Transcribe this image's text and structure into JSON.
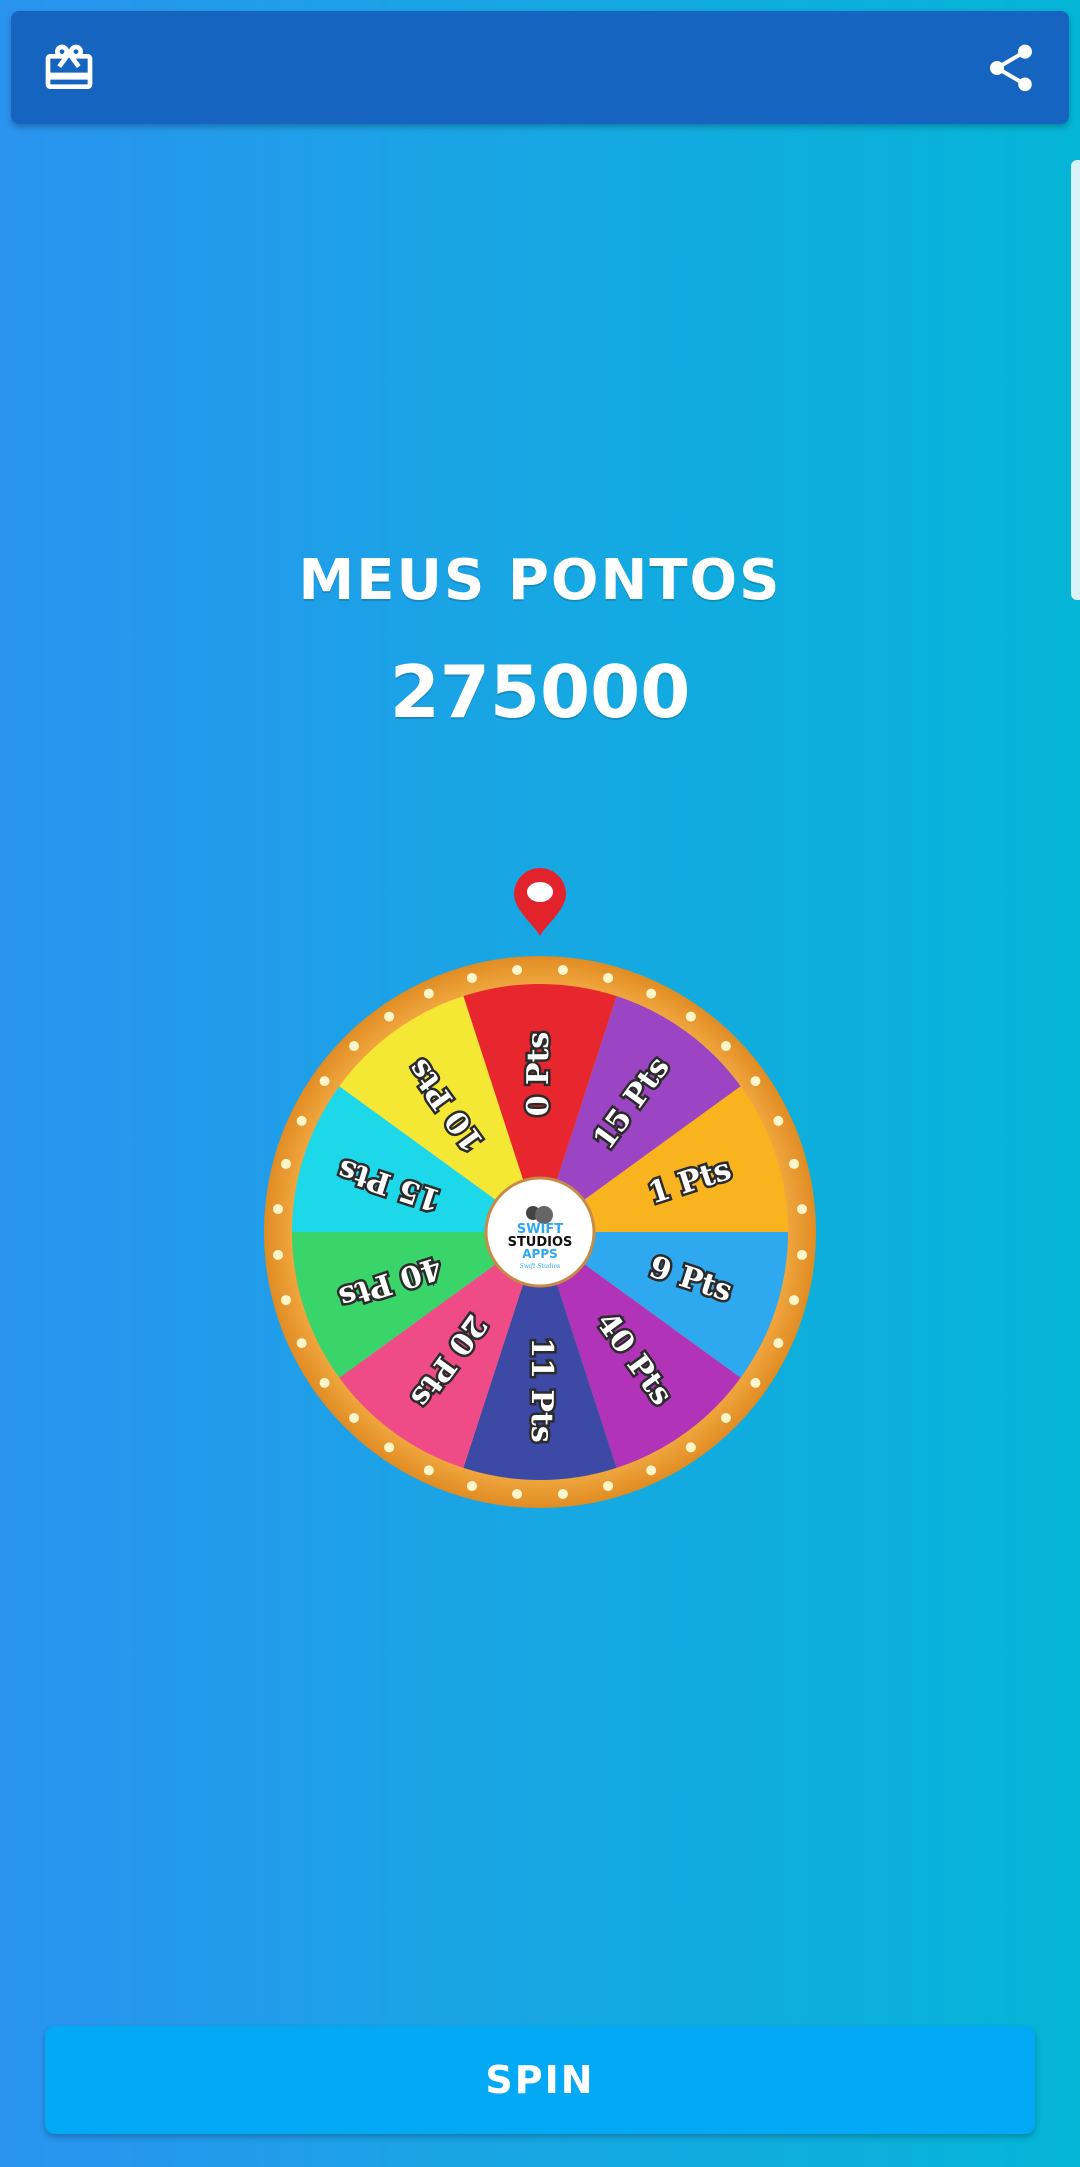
{
  "toolbar": {
    "left_icon": "gift-card-icon",
    "right_icon": "share-icon"
  },
  "points_panel": {
    "title": "MEUS PONTOS",
    "value": "275000"
  },
  "wheel": {
    "pointer_icon": "map-pin-icon",
    "center_logo": {
      "line1": "SWIFT",
      "line2": "STUDIOS",
      "line3": "APPS",
      "line4": "Swift Studios"
    },
    "segments": [
      {
        "label": "0 Pts",
        "color": "#e8262e"
      },
      {
        "label": "15 Pts",
        "color": "#9b44c4"
      },
      {
        "label": "1 Pts",
        "color": "#f9b31f"
      },
      {
        "label": "9 Pts",
        "color": "#2ea8ee"
      },
      {
        "label": "40 Pts",
        "color": "#b033b8"
      },
      {
        "label": "11 Pts",
        "color": "#3d4aa5"
      },
      {
        "label": "20 Pts",
        "color": "#ef4b86"
      },
      {
        "label": "40 Pts",
        "color": "#39d46a"
      },
      {
        "label": "15 Pts",
        "color": "#1cd8e8"
      },
      {
        "label": "10 Pts",
        "color": "#f5e835"
      }
    ],
    "rim_color": "#f2a23a"
  },
  "spin_button": {
    "label": "SPIN"
  }
}
